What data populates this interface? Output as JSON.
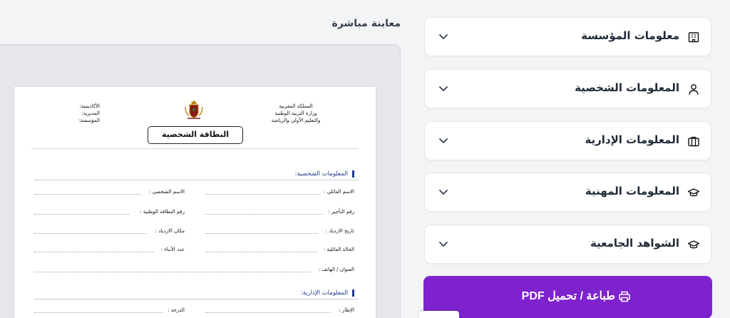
{
  "accordion": [
    {
      "title": "معلومات المؤسسة",
      "icon": "building-icon"
    },
    {
      "title": "المعلومات الشخصية",
      "icon": "user-icon"
    },
    {
      "title": "المعلومات الإدارية",
      "icon": "briefcase-icon"
    },
    {
      "title": "المعلومات المهنية",
      "icon": "graduation-cap-icon"
    },
    {
      "title": "الشواهد الجامعية",
      "icon": "graduation-cap-icon"
    }
  ],
  "print_button": {
    "label": "طباعة / تحميل PDF",
    "icon": "printer-icon",
    "color": "#7e22ce"
  },
  "preview": {
    "title": "معاينة مباشرة",
    "document": {
      "header_right": [
        "المملكة المغربية",
        "وزارة التربية الوطنية",
        "والتعليم الأولي والرياضة"
      ],
      "header_left": [
        "الأكاديمية:",
        "المديرية:",
        "المؤسسة:"
      ],
      "card_title": "البطاقة الشخصية",
      "personal_section": "المعلومات الشخصية:",
      "personal_fields": {
        "family_name": "الاسم العائلي :",
        "first_name": "الاسم الشخصي :",
        "staff_number": "رقم التأجير :",
        "cin": "رقم البطاقة الوطنية :",
        "birth_date": "تاريخ الازدياد :",
        "birth_place": "مكان الازدياد :",
        "marital_status": "الحالة العائلية :",
        "children": "عدد الأبناء :",
        "address_phone": "العنوان / الهاتف :"
      },
      "admin_section": "المعلومات الإدارية:",
      "admin_fields": {
        "framework": "الإطار :",
        "grade": "الدرجة :"
      }
    }
  }
}
